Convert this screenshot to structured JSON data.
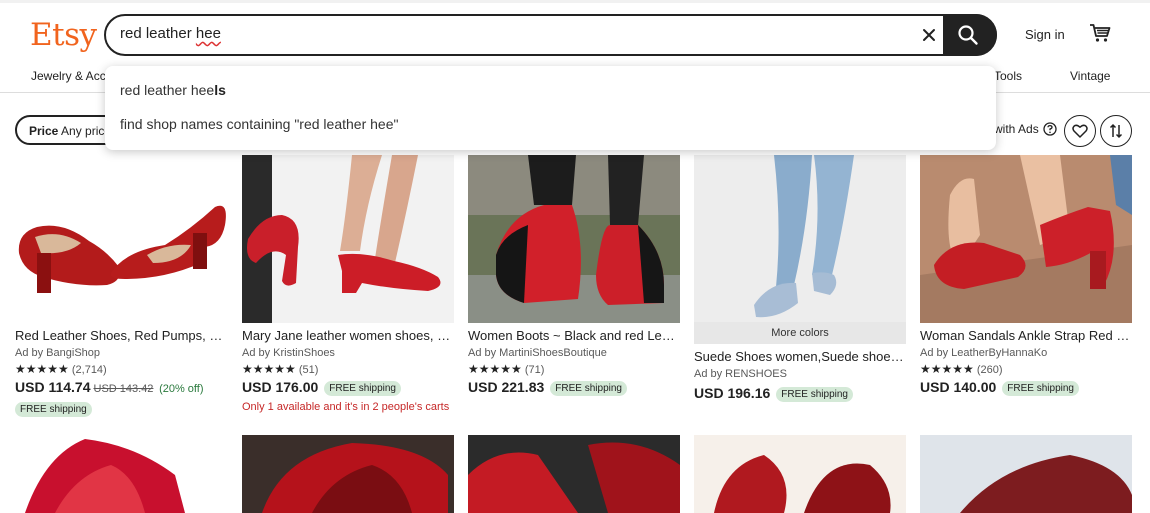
{
  "header": {
    "logo": "Etsy",
    "search_value": "red leather ",
    "search_value_tail": "hee",
    "sign_in": "Sign in"
  },
  "nav": {
    "items": [
      "Jewelry & Acc",
      "Tools",
      "Vintage"
    ]
  },
  "suggestions": {
    "item1_prefix": "red leather hee",
    "item1_bold": "ls",
    "item2": "find shop names containing \"red leather hee\""
  },
  "filters": {
    "price_label": "Price",
    "price_value": "Any price",
    "ads_label": "with Ads"
  },
  "listings": [
    {
      "title": "Red Leather Shoes, Red Pumps, He...",
      "seller": "Ad by BangiShop",
      "stars": "★★★★★",
      "reviews": "(2,714)",
      "price": "USD 114.74",
      "old_price": "USD 143.42",
      "discount": "(20% off)",
      "shipping": "FREE shipping"
    },
    {
      "title": "Mary Jane leather women shoes, R...",
      "seller": "Ad by KristinShoes",
      "stars": "★★★★★",
      "reviews": "(51)",
      "price": "USD 176.00",
      "shipping": "FREE shipping",
      "note": "Only 1 available and it's in 2 people's carts"
    },
    {
      "title": "Women Boots ~ Black and red Leat...",
      "seller": "Ad by MartiniShoesBoutique",
      "stars": "★★★★★",
      "reviews": "(71)",
      "price": "USD 221.83",
      "shipping": "FREE shipping"
    },
    {
      "title": "Suede Shoes women,Suede shoes,...",
      "seller": "Ad by RENSHOES",
      "badge": "More colors",
      "price": "USD 196.16",
      "shipping": "FREE shipping"
    },
    {
      "title": "Woman Sandals Ankle Strap Red S...",
      "seller": "Ad by LeatherByHannaKo",
      "stars": "★★★★★",
      "reviews": "(260)",
      "price": "USD 140.00",
      "shipping": "FREE shipping"
    }
  ],
  "colors": {
    "brand": "#f1641e",
    "free_shipping_bg": "#d4e9d7",
    "scarcity": "#c62828"
  }
}
